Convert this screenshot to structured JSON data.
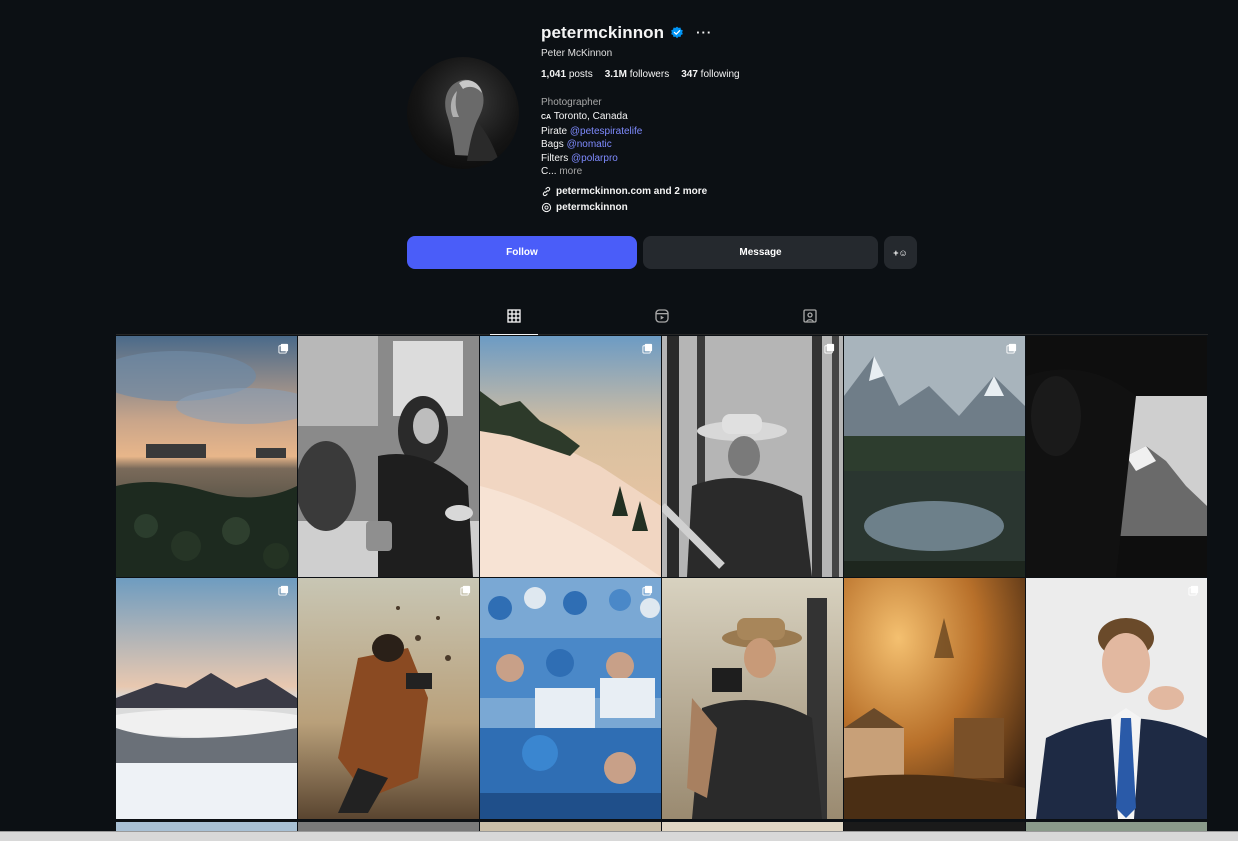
{
  "profile": {
    "username": "petermckinnon",
    "full_name": "Peter McKinnon",
    "stats": {
      "posts": "1,041",
      "posts_label": "posts",
      "followers": "3.1M",
      "followers_label": "followers",
      "following": "347",
      "following_label": "following"
    },
    "category": "Photographer",
    "bio": {
      "flag": "CA",
      "location": "Toronto, Canada",
      "line2_prefix": "Pirate ",
      "line2_link": "@petespiratelife",
      "line3_prefix": "Bags ",
      "line3_link": "@nomatic",
      "line4_prefix": "Filters ",
      "line4_link": "@polarpro",
      "line5_prefix": "C...",
      "more": "more"
    },
    "external_link": "petermckinnon.com and 2 more",
    "threads_handle": "petermckinnon"
  },
  "actions": {
    "follow": "Follow",
    "message": "Message",
    "add_user": "+☺"
  },
  "tabs": [
    {
      "name": "posts",
      "icon": "grid-icon",
      "active": true
    },
    {
      "name": "reels",
      "icon": "reels-icon",
      "active": false
    },
    {
      "name": "tagged",
      "icon": "tagged-icon",
      "active": false
    }
  ],
  "grid_posts": [
    {
      "subject": "city skyline sunset over rocky shore",
      "multi": true
    },
    {
      "subject": "man with turkey at table black and white",
      "multi": false
    },
    {
      "subject": "snowy mountain slope at sunrise",
      "multi": true
    },
    {
      "subject": "cowboy in forest black and white",
      "multi": true
    },
    {
      "subject": "mountain lake with reflections",
      "multi": true
    },
    {
      "subject": "mountain through airplane window",
      "multi": false
    },
    {
      "subject": "snowy peaks above clouds",
      "multi": true
    },
    {
      "subject": "photographer crouching with camera",
      "multi": true
    },
    {
      "subject": "baseball fans in blue jerseys",
      "multi": true
    },
    {
      "subject": "man with camera and hat",
      "multi": false
    },
    {
      "subject": "golden foggy forest",
      "multi": false
    },
    {
      "subject": "man in suit portrait",
      "multi": true
    }
  ],
  "colors": {
    "background": "#0c1014",
    "follow_button": "#4a5df9",
    "secondary_button": "#25292e",
    "link": "#7f8bff",
    "verified": "#0095f6"
  }
}
